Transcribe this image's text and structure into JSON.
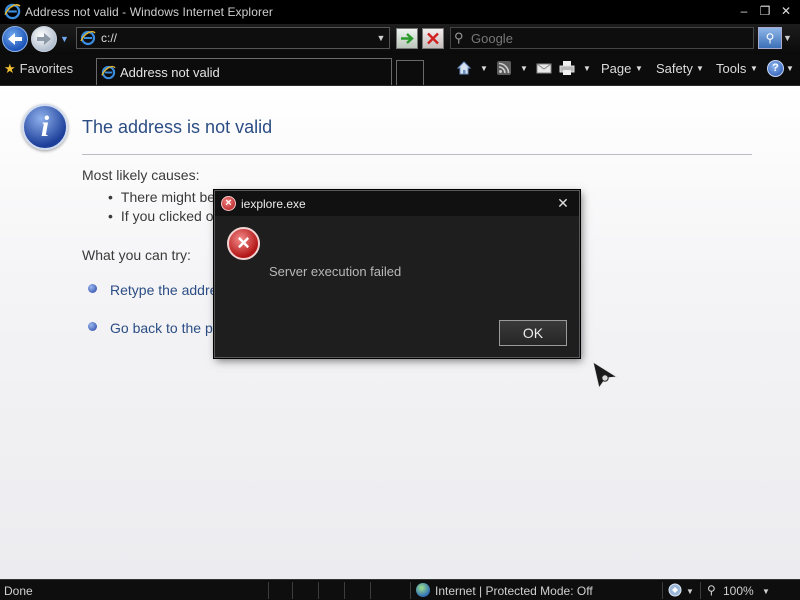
{
  "window": {
    "title": "Address not valid - Windows Internet Explorer",
    "minimize": "–",
    "maximize": "❐",
    "close": "✕"
  },
  "navbar": {
    "address": "c://",
    "search_placeholder": "Google"
  },
  "commandbar": {
    "favorites_label": "Favorites",
    "tab_label": "Address not valid",
    "page_label": "Page",
    "safety_label": "Safety",
    "tools_label": "Tools",
    "help_label": "?"
  },
  "page": {
    "title": "The address is not valid",
    "causes_heading": "Most likely causes:",
    "causes": [
      "There might be",
      "If you clicked o"
    ],
    "try_heading": "What you can try:",
    "try_items": [
      "Retype the addre",
      "Go back to the p"
    ]
  },
  "dialog": {
    "title": "iexplore.exe",
    "close": "✕",
    "message": "Server execution failed",
    "ok_label": "OK"
  },
  "statusbar": {
    "status": "Done",
    "zone": "Internet | Protected Mode: Off",
    "zoom": "100%"
  },
  "colors": {
    "title_accent": "#2b4d84",
    "error_red": "#b31515",
    "info_blue": "#1d3f9a"
  },
  "icons": {
    "app": "ie-icon",
    "info": "info-icon",
    "error": "error-icon",
    "home": "home-icon",
    "feeds": "feeds-icon",
    "mail": "mail-icon",
    "print": "print-icon",
    "help": "help-icon",
    "zone": "globe-icon",
    "zoom": "magnifier-icon"
  }
}
